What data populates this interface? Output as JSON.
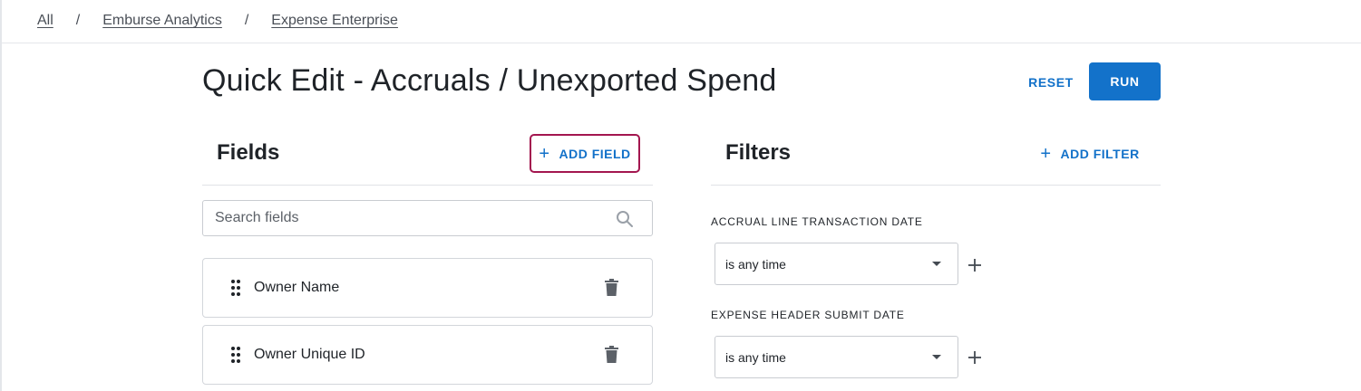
{
  "breadcrumb": {
    "items": [
      "All",
      "Emburse Analytics",
      "Expense Enterprise"
    ],
    "separator": "/"
  },
  "page": {
    "title": "Quick Edit - Accruals / Unexported Spend"
  },
  "actions": {
    "reset_label": "RESET",
    "run_label": "RUN"
  },
  "fields": {
    "heading": "Fields",
    "add_label": "ADD FIELD",
    "search_placeholder": "Search fields",
    "items": [
      {
        "label": "Owner Name"
      },
      {
        "label": "Owner Unique ID"
      }
    ]
  },
  "filters": {
    "heading": "Filters",
    "add_label": "ADD FILTER",
    "items": [
      {
        "label": "ACCRUAL LINE TRANSACTION DATE",
        "value": "is any time"
      },
      {
        "label": "EXPENSE HEADER SUBMIT DATE",
        "value": "is any time"
      }
    ]
  },
  "icons": {
    "search": "search-icon",
    "drag": "drag-handle-icon",
    "delete": "trash-icon",
    "add": "plus-icon",
    "dropdown": "chevron-down-icon"
  },
  "colors": {
    "accent": "#1372ca",
    "focus_outline": "#a3164f",
    "text": "#1f2328"
  }
}
